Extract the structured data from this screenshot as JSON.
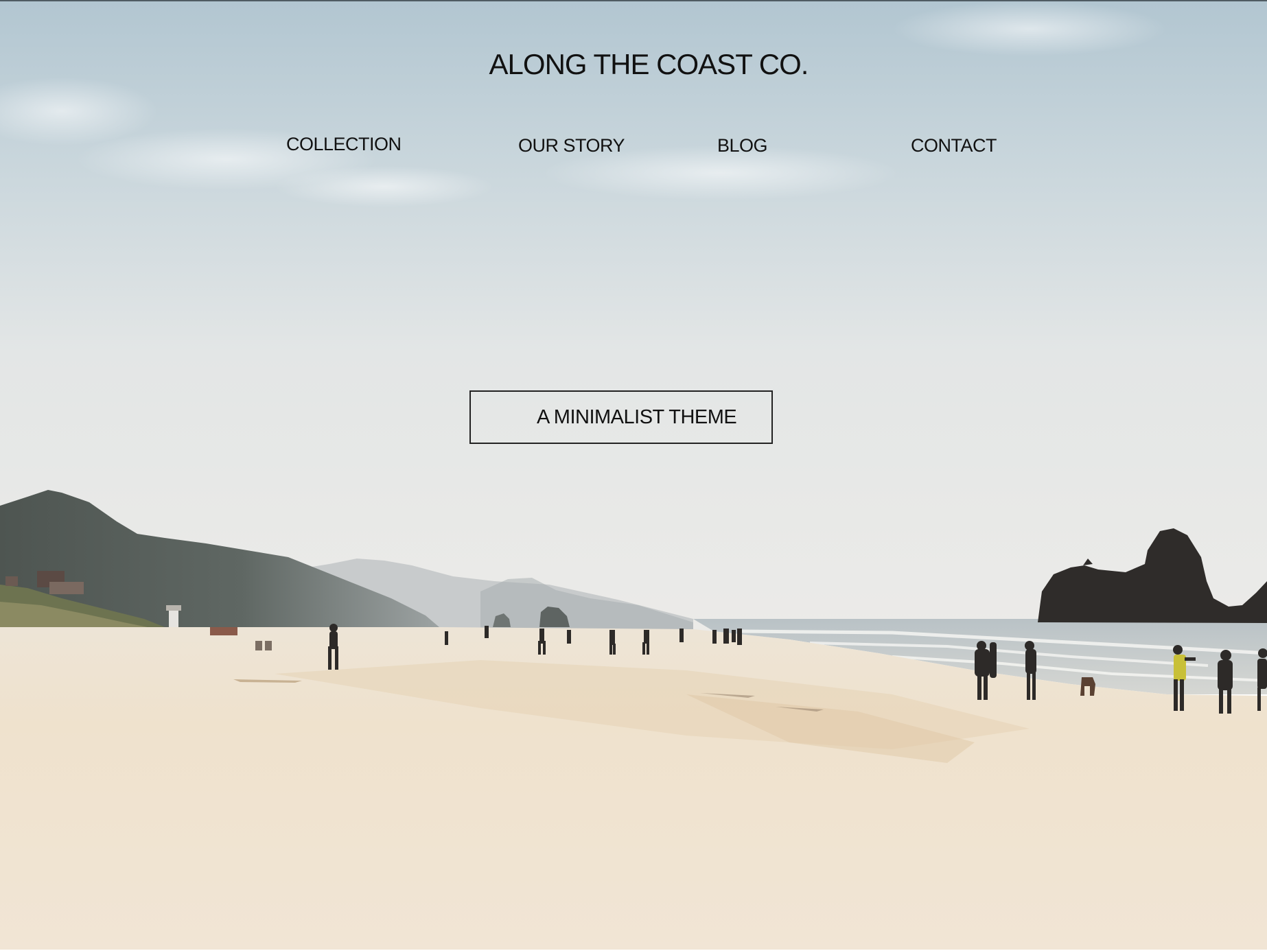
{
  "brand": {
    "title": "ALONG THE COAST CO."
  },
  "nav": {
    "items": [
      {
        "label": "COLLECTION"
      },
      {
        "label": "OUR STORY"
      },
      {
        "label": "BLOG"
      },
      {
        "label": "CONTACT"
      }
    ]
  },
  "hero": {
    "cta_label": "A MINIMALIST THEME"
  },
  "colors": {
    "sky_top": "#b3c7d2",
    "sky_bottom": "#e9ebea",
    "sand": "#efe3d0",
    "text": "#111111"
  }
}
